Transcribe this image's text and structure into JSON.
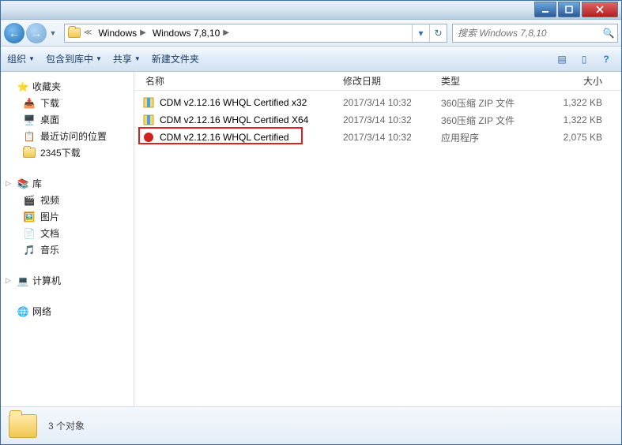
{
  "titlebar": {
    "window_title": ""
  },
  "nav": {
    "breadcrumbs": [
      "Windows",
      "Windows 7,8,10"
    ],
    "search_placeholder": "搜索 Windows 7,8,10"
  },
  "toolbar": {
    "organize": "组织",
    "include": "包含到库中",
    "share": "共享",
    "new_folder": "新建文件夹"
  },
  "sidebar": {
    "favorites": {
      "label": "收藏夹",
      "items": [
        "下载",
        "桌面",
        "最近访问的位置",
        "2345下载"
      ]
    },
    "libraries": {
      "label": "库",
      "items": [
        "视频",
        "图片",
        "文档",
        "音乐"
      ]
    },
    "computer": {
      "label": "计算机"
    },
    "network": {
      "label": "网络"
    }
  },
  "columns": {
    "name": "名称",
    "date": "修改日期",
    "type": "类型",
    "size": "大小"
  },
  "files": [
    {
      "name": "CDM v2.12.16 WHQL Certified x32",
      "date": "2017/3/14 10:32",
      "type": "360压缩 ZIP 文件",
      "size": "1,322 KB",
      "icon": "zip"
    },
    {
      "name": "CDM v2.12.16 WHQL Certified X64",
      "date": "2017/3/14 10:32",
      "type": "360压缩 ZIP 文件",
      "size": "1,322 KB",
      "icon": "zip"
    },
    {
      "name": "CDM v2.12.16 WHQL Certified",
      "date": "2017/3/14 10:32",
      "type": "应用程序",
      "size": "2,075 KB",
      "icon": "exe",
      "highlighted": true
    }
  ],
  "statusbar": {
    "count_text": "3 个对象"
  }
}
